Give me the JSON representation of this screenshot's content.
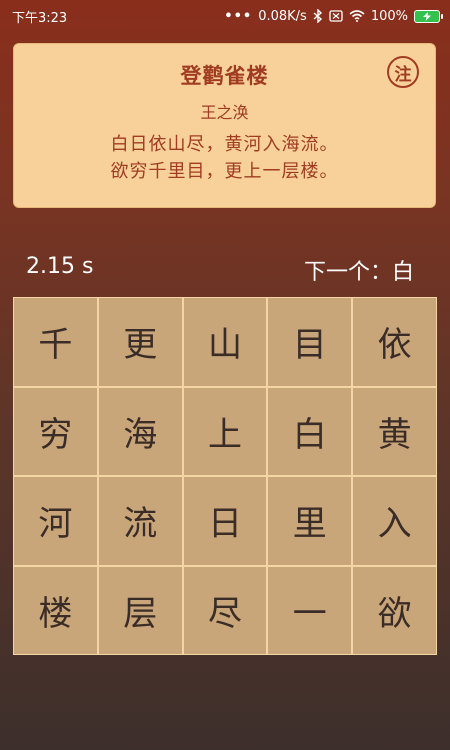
{
  "status_bar": {
    "time": "下午3:23",
    "net_speed": "0.08K/s",
    "battery": "100%"
  },
  "poem": {
    "title": "登鹳雀楼",
    "author": "王之涣",
    "lines": [
      "白日依山尽，黄河入海流。",
      "欲穷千里目，更上一层楼。"
    ],
    "note_label": "注"
  },
  "game": {
    "timer": "2.15 s",
    "next_prefix": "下一个：",
    "next_char": "白",
    "grid": [
      [
        "千",
        "更",
        "山",
        "目",
        "依"
      ],
      [
        "穷",
        "海",
        "上",
        "白",
        "黄"
      ],
      [
        "河",
        "流",
        "日",
        "里",
        "入"
      ],
      [
        "楼",
        "层",
        "尽",
        "一",
        "欲"
      ]
    ]
  }
}
